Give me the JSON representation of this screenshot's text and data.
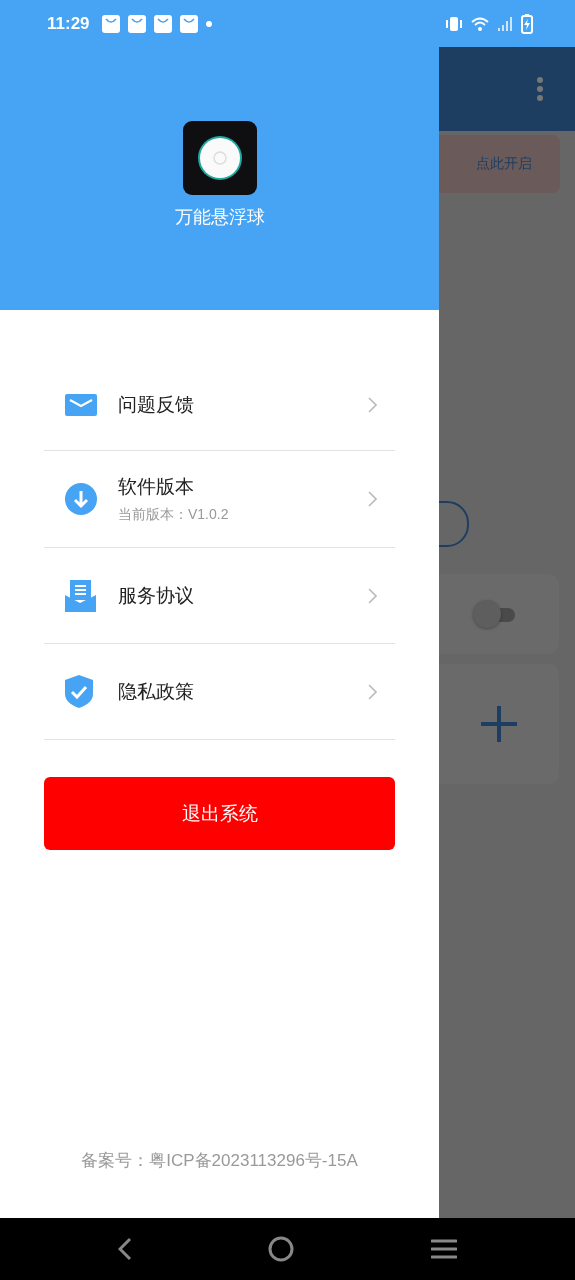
{
  "status_bar": {
    "time": "11:29"
  },
  "drawer": {
    "app_name": "万能悬浮球",
    "menu": [
      {
        "kind": "mail",
        "label": "问题反馈"
      },
      {
        "kind": "download",
        "label": "软件版本",
        "subtitle": "当前版本：V1.0.2"
      },
      {
        "kind": "document",
        "label": "服务协议"
      },
      {
        "kind": "shield",
        "label": "隐私政策"
      }
    ],
    "logout_button": "退出系统",
    "footer": "备案号：粤ICP备2023113296号-15A"
  },
  "background_screen": {
    "banner_button": "点此开启",
    "switch": {
      "on": false
    }
  }
}
